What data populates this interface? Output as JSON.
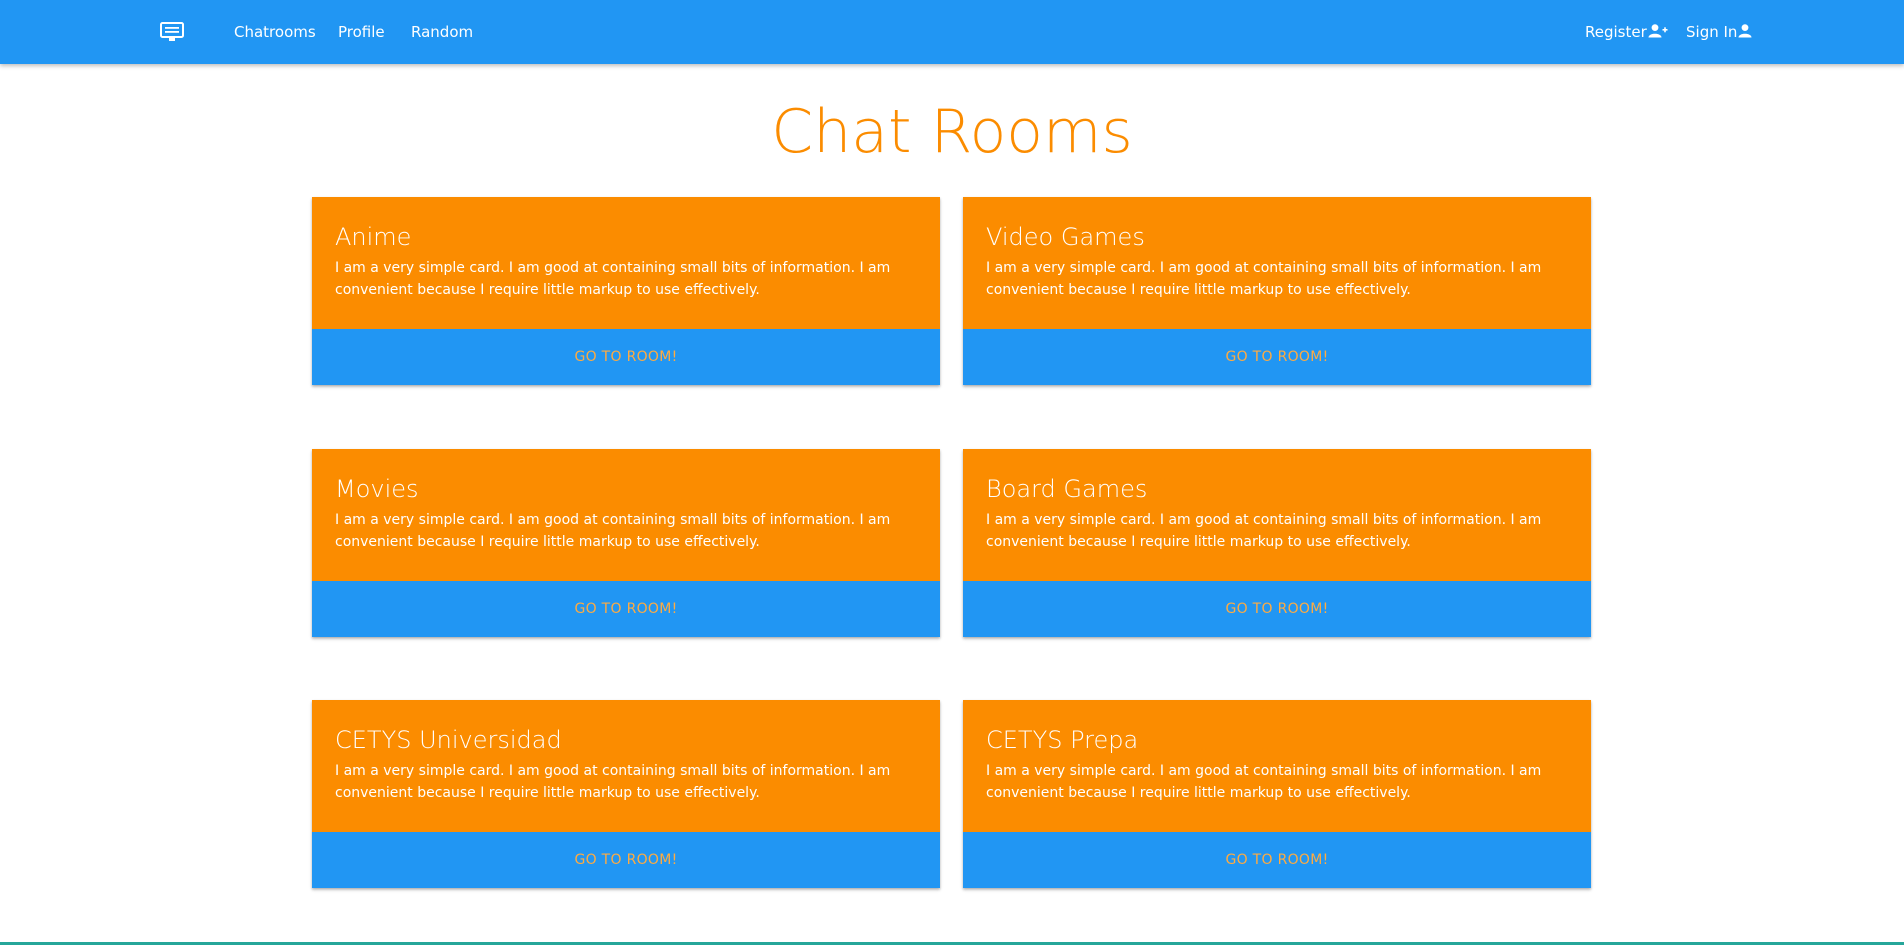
{
  "nav": {
    "links": [
      {
        "label": "Chatrooms"
      },
      {
        "label": "Profile"
      },
      {
        "label": "Random"
      }
    ],
    "register_label": "Register",
    "signin_label": "Sign In",
    "icons": {
      "logo": "chat-bubble-icon",
      "register": "person-add-icon",
      "signin": "person-icon"
    }
  },
  "page": {
    "title": "Chat Rooms"
  },
  "rooms": [
    {
      "title": "Anime",
      "description": "I am a very simple card. I am good at containing small bits of information. I am convenient because I require little markup to use effectively.",
      "action": "GO TO ROOM!"
    },
    {
      "title": "Video Games",
      "description": "I am a very simple card. I am good at containing small bits of information. I am convenient because I require little markup to use effectively.",
      "action": "GO TO ROOM!"
    },
    {
      "title": "Movies",
      "description": "I am a very simple card. I am good at containing small bits of information. I am convenient because I require little markup to use effectively.",
      "action": "GO TO ROOM!"
    },
    {
      "title": "Board Games",
      "description": "I am a very simple card. I am good at containing small bits of information. I am convenient because I require little markup to use effectively.",
      "action": "GO TO ROOM!"
    },
    {
      "title": "CETYS Universidad",
      "description": "I am a very simple card. I am good at containing small bits of information. I am convenient because I require little markup to use effectively.",
      "action": "GO TO ROOM!"
    },
    {
      "title": "CETYS Prepa",
      "description": "I am a very simple card. I am good at containing small bits of information. I am convenient because I require little markup to use effectively.",
      "action": "GO TO ROOM!"
    }
  ],
  "colors": {
    "primary": "#2196f3",
    "accent": "#fb8c00",
    "action_text": "#ffab40",
    "background": "#ffffff"
  }
}
